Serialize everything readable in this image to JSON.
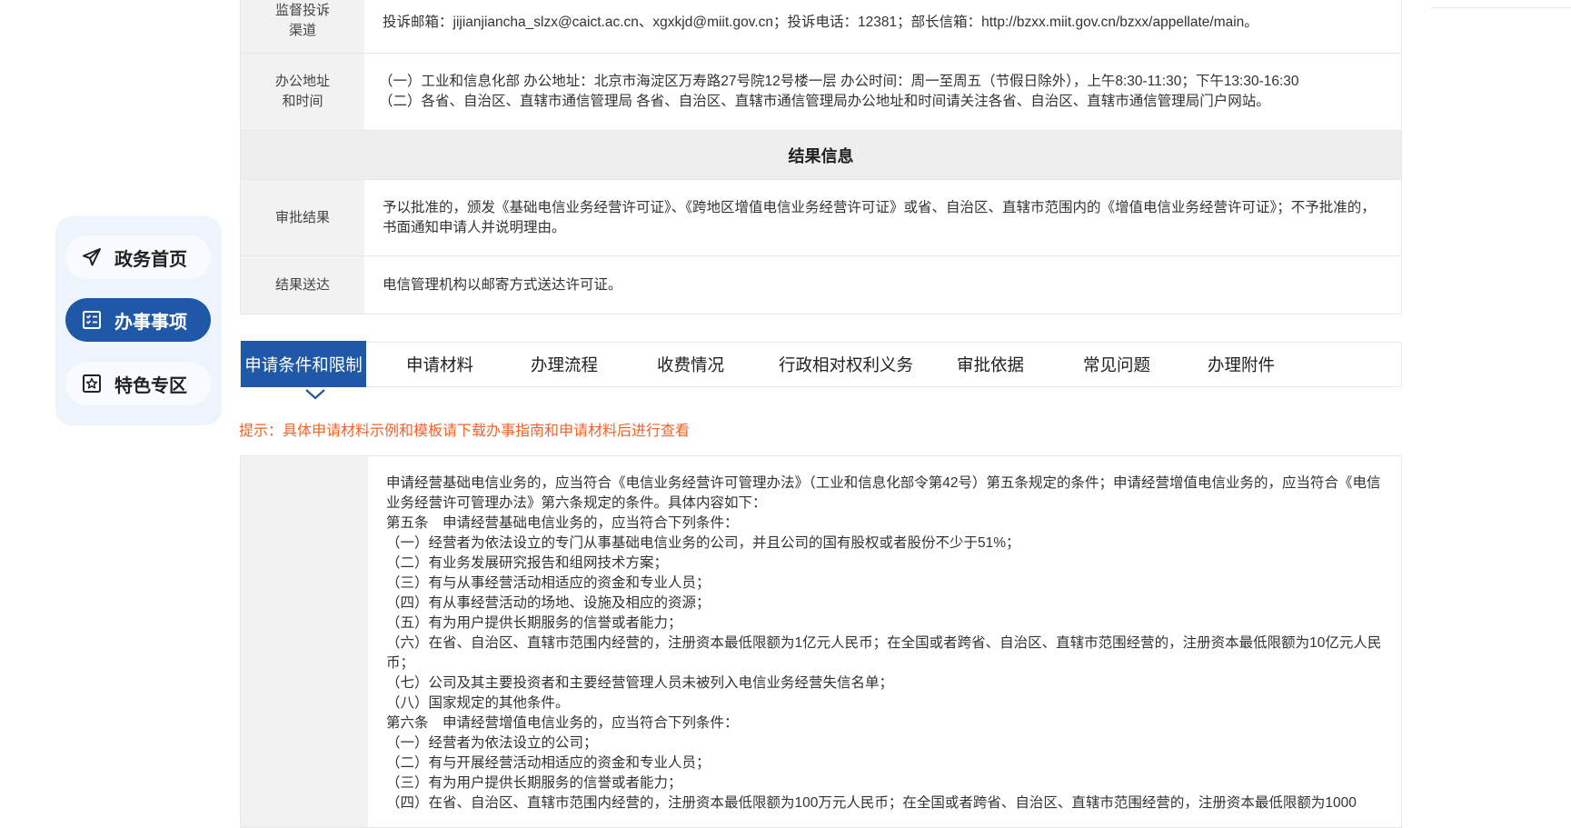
{
  "info_rows": [
    {
      "label": "监督投诉\n渠道",
      "value": "投诉邮箱：jijianjiancha_slzx@caict.ac.cn、xgxkjd@miit.gov.cn；投诉电话：12381；部长信箱：http://bzxx.miit.gov.cn/bzxx/appellate/main。"
    },
    {
      "label": "办公地址\n和时间",
      "value": "（一）工业和信息化部 办公地址：北京市海淀区万寿路27号院12号楼一层 办公时间：周一至周五（节假日除外），上午8:30-11:30；下午13:30-16:30\n（二）各省、自治区、直辖市通信管理局 各省、自治区、直辖市通信管理局办公地址和时间请关注各省、自治区、直辖市通信管理局门户网站。"
    }
  ],
  "result_section": {
    "title": "结果信息",
    "rows": [
      {
        "label": "审批结果",
        "value": "予以批准的，颁发《基础电信业务经营许可证》、《跨地区增值电信业务经营许可证》或省、自治区、直辖市范围内的《增值电信业务经营许可证》；不予批准的，书面通知申请人并说明理由。"
      },
      {
        "label": "结果送达",
        "value": "电信管理机构以邮寄方式送达许可证。"
      }
    ]
  },
  "sidenav": {
    "items": [
      {
        "label": "政务首页",
        "icon": "paper-plane-icon"
      },
      {
        "label": "办事事项",
        "icon": "checklist-icon"
      },
      {
        "label": "特色专区",
        "icon": "star-icon"
      }
    ]
  },
  "tabs": [
    {
      "label": "申请条件和限制"
    },
    {
      "label": "申请材料"
    },
    {
      "label": "办理流程"
    },
    {
      "label": "收费情况"
    },
    {
      "label": "行政相对权利义务"
    },
    {
      "label": "审批依据"
    },
    {
      "label": "常见问题"
    },
    {
      "label": "办理附件"
    }
  ],
  "active_tab": "申请条件和限制",
  "tip": "提示：具体申请材料示例和模板请下载办事指南和申请材料后进行查看",
  "conditions": [
    "申请经营基础电信业务的，应当符合《电信业务经营许可管理办法》（工业和信息化部令第42号）第五条规定的条件；申请经营增值电信业务的，应当符合《电信业务经营许可管理办法》第六条规定的条件。具体内容如下：",
    "第五条　申请经营基础电信业务的，应当符合下列条件：",
    "（一）经营者为依法设立的专门从事基础电信业务的公司，并且公司的国有股权或者股份不少于51%；",
    "（二）有业务发展研究报告和组网技术方案；",
    "（三）有与从事经营活动相适应的资金和专业人员；",
    "（四）有从事经营活动的场地、设施及相应的资源；",
    "（五）有为用户提供长期服务的信誉或者能力；",
    "（六）在省、自治区、直辖市范围内经营的，注册资本最低限额为1亿元人民币；在全国或者跨省、自治区、直辖市范围经营的，注册资本最低限额为10亿元人民币；",
    "（七）公司及其主要投资者和主要经营管理人员未被列入电信业务经营失信名单；",
    "（八）国家规定的其他条件。",
    "第六条　申请经营增值电信业务的，应当符合下列条件：",
    "（一）经营者为依法设立的公司；",
    "（二）有与开展经营活动相适应的资金和专业人员；",
    "（三）有为用户提供长期服务的信誉或者能力；",
    "（四）在省、自治区、直辖市范围内经营的，注册资本最低限额为100万元人民币；在全国或者跨省、自治区、直辖市范围经营的，注册资本最低限额为1000"
  ],
  "colors": {
    "primary": "#1f58a6",
    "tip": "#f0622a",
    "label_bg": "#f2f2f2"
  }
}
